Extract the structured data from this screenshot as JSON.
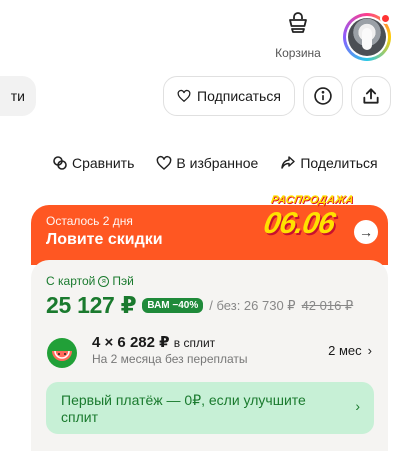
{
  "header": {
    "cart_label": "Корзина"
  },
  "toolbar": {
    "left_button_fragment": "ти",
    "subscribe_label": "Подписаться"
  },
  "actions": {
    "compare": "Сравнить",
    "favorite": "В избранное",
    "share": "Поделиться"
  },
  "promo": {
    "subtitle": "Осталось 2 дня",
    "title": "Ловите скидки",
    "sale_word": "РАСПРОДАЖА",
    "sale_date": "06.06",
    "accent_color": "#ff5722",
    "sale_color": "#ffe100"
  },
  "price": {
    "with_card_prefix": "С картой",
    "card_name": "Пэй",
    "current": "25 127 ₽",
    "discount_badge": "ВАМ −40%",
    "without_label": "/ без: 26 730 ₽",
    "old_price": "42 016 ₽",
    "accent_color": "#1a7a2e"
  },
  "split": {
    "main": "4 × 6 282 ₽",
    "main_suffix": "в сплит",
    "subtitle": "На 2 месяца без переплаты",
    "term": "2 мес"
  },
  "banner": {
    "text": "Первый платёж — 0₽, если улучшите сплит",
    "background": "#c7f0d6"
  }
}
